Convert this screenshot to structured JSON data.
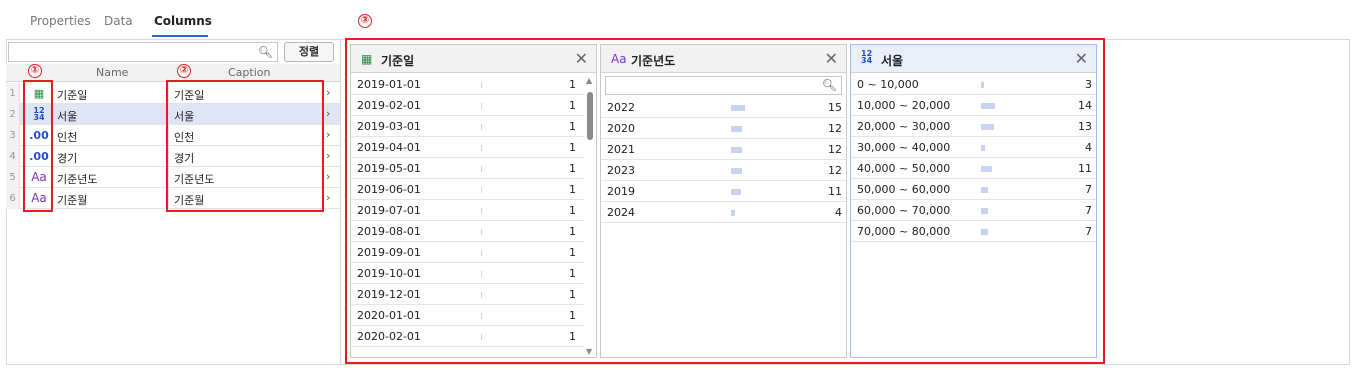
{
  "tabs": [
    {
      "label": "Properties"
    },
    {
      "label": "Data"
    },
    {
      "label": "Columns"
    }
  ],
  "search": {
    "value": "",
    "placeholder": ""
  },
  "sort_button": "정렬",
  "grid": {
    "header_name": "Name",
    "header_caption": "Caption",
    "rows": [
      {
        "num": "1",
        "type": "date",
        "icon_text": "▦",
        "name": "기준일",
        "caption": "기준일"
      },
      {
        "num": "2",
        "type": "number",
        "icon_text": "12 34",
        "name": "서울",
        "caption": "서울"
      },
      {
        "num": "3",
        "type": "decimal",
        "icon_text": ".00",
        "name": "인천",
        "caption": "인천"
      },
      {
        "num": "4",
        "type": "decimal",
        "icon_text": ".00",
        "name": "경기",
        "caption": "경기"
      },
      {
        "num": "5",
        "type": "text",
        "icon_text": "Aa",
        "name": "기준년도",
        "caption": "기준년도"
      },
      {
        "num": "6",
        "type": "text",
        "icon_text": "Aa",
        "name": "기준월",
        "caption": "기준월"
      }
    ]
  },
  "annotations": [
    "①",
    "②",
    "③"
  ],
  "panels": [
    {
      "icon": "calendar-icon",
      "icon_text": "▦",
      "title": "기준일",
      "close": "✕",
      "max_count": 1,
      "rows": [
        {
          "label": "2019-01-01",
          "count": 1
        },
        {
          "label": "2019-02-01",
          "count": 1
        },
        {
          "label": "2019-03-01",
          "count": 1
        },
        {
          "label": "2019-04-01",
          "count": 1
        },
        {
          "label": "2019-05-01",
          "count": 1
        },
        {
          "label": "2019-06-01",
          "count": 1
        },
        {
          "label": "2019-07-01",
          "count": 1
        },
        {
          "label": "2019-08-01",
          "count": 1
        },
        {
          "label": "2019-09-01",
          "count": 1
        },
        {
          "label": "2019-10-01",
          "count": 1
        },
        {
          "label": "2019-12-01",
          "count": 1
        },
        {
          "label": "2020-01-01",
          "count": 1
        },
        {
          "label": "2020-02-01",
          "count": 1
        }
      ]
    },
    {
      "icon": "text-type-icon",
      "icon_text": "Aa",
      "title": "기준년도",
      "close": "✕",
      "search_placeholder": "",
      "max_count": 15,
      "rows": [
        {
          "label": "2022",
          "count": 15
        },
        {
          "label": "2020",
          "count": 12
        },
        {
          "label": "2021",
          "count": 12
        },
        {
          "label": "2023",
          "count": 12
        },
        {
          "label": "2019",
          "count": 11
        },
        {
          "label": "2024",
          "count": 4
        }
      ]
    },
    {
      "icon": "number-type-icon",
      "icon_text": "12 34",
      "title": "서울",
      "close": "✕",
      "max_count": 14,
      "rows": [
        {
          "label": "0 ~ 10,000",
          "count": 3
        },
        {
          "label": "10,000 ~ 20,000",
          "count": 14
        },
        {
          "label": "20,000 ~ 30,000",
          "count": 13
        },
        {
          "label": "30,000 ~ 40,000",
          "count": 4
        },
        {
          "label": "40,000 ~ 50,000",
          "count": 11
        },
        {
          "label": "50,000 ~ 60,000",
          "count": 7
        },
        {
          "label": "60,000 ~ 70,000",
          "count": 7
        },
        {
          "label": "70,000 ~ 80,000",
          "count": 7
        }
      ]
    }
  ]
}
